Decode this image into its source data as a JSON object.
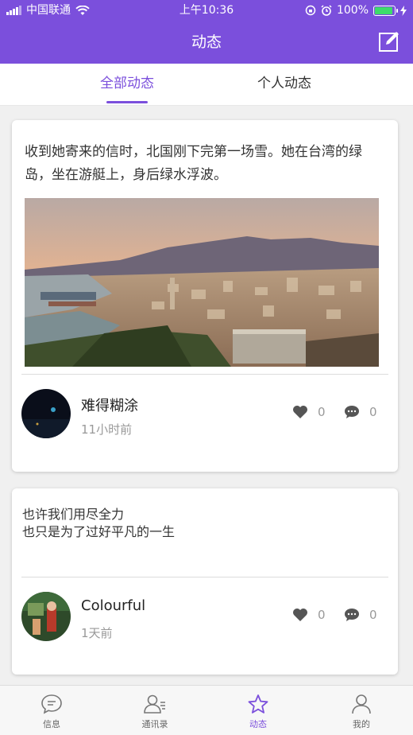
{
  "status_bar": {
    "carrier": "中国联通",
    "time": "上午10:36",
    "battery": "100%"
  },
  "header": {
    "title": "动态",
    "edit_icon": "edit-icon"
  },
  "tabs": [
    {
      "label": "全部动态",
      "active": true
    },
    {
      "label": "个人动态",
      "active": false
    }
  ],
  "posts": [
    {
      "text": "收到她寄来的信时，北国刚下完第一场雪。她在台湾的绿岛，坐在游艇上，身后绿水浮波。",
      "has_image": true,
      "image_icon": "city-landscape-photo",
      "author": "难得糊涂",
      "time": "11小时前",
      "likes": "0",
      "comments": "0"
    },
    {
      "text_lines": [
        "也许我们用尽全力",
        "也只是为了过好平凡的一生"
      ],
      "has_image": false,
      "author": "Colourful",
      "time": "1天前",
      "likes": "0",
      "comments": "0"
    }
  ],
  "bottom_nav": [
    {
      "label": "信息",
      "icon": "chat-bubble-icon",
      "active": false
    },
    {
      "label": "通讯录",
      "icon": "contacts-icon",
      "active": false
    },
    {
      "label": "动态",
      "icon": "star-icon",
      "active": true
    },
    {
      "label": "我的",
      "icon": "person-icon",
      "active": false
    }
  ],
  "colors": {
    "accent": "#7b4fdc",
    "background": "#f0f0f0",
    "text_muted": "#999999"
  }
}
